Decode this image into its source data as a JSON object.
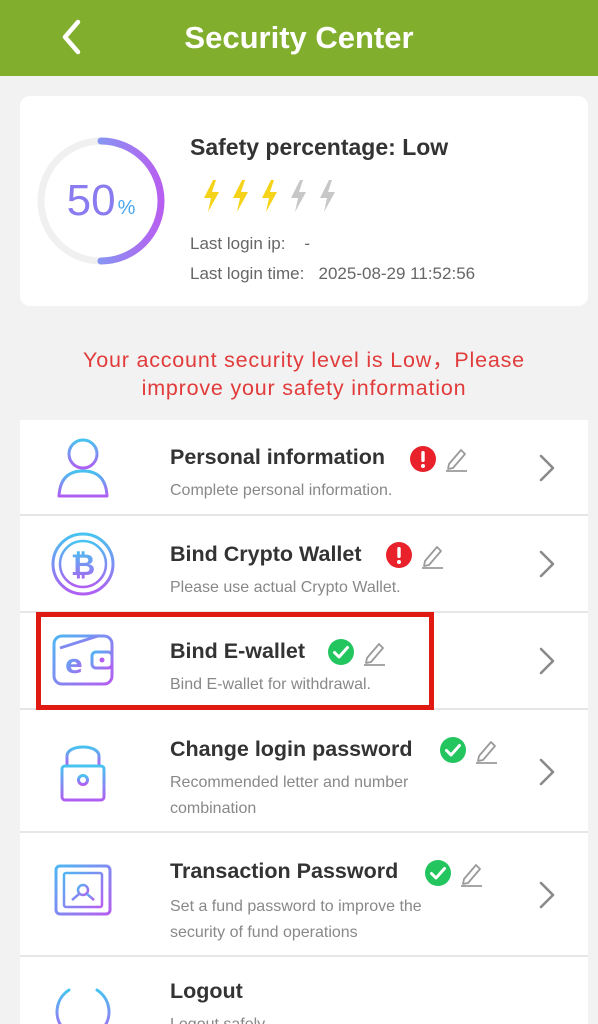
{
  "header": {
    "title": "Security Center"
  },
  "summary": {
    "percent": "50",
    "percent_sign": "%",
    "safety_label": "Safety percentage: Low",
    "bolts_lit": 3,
    "bolts_total": 5,
    "last_login_ip": "Last login ip:    -",
    "last_login_time": "Last login time:   2025-08-29 11:52:56"
  },
  "warning": {
    "line1": "Your account security level is Low，Please",
    "line2": "improve your safety information"
  },
  "colors": {
    "header": "#82ae2e",
    "warning": "#e23b3b",
    "ok": "#22c55e",
    "alert": "#e8212a",
    "bolt_on": "#f5d31a",
    "bolt_off": "#c7c7c7"
  },
  "menu": [
    {
      "title": "Personal information",
      "desc": "Complete personal information.",
      "status": "alert",
      "icon": "user-icon"
    },
    {
      "title": "Bind Crypto Wallet",
      "desc": "Please use actual Crypto Wallet.",
      "status": "alert",
      "icon": "bitcoin-icon"
    },
    {
      "title": "Bind E-wallet",
      "desc": "Bind E-wallet for withdrawal.",
      "status": "ok",
      "icon": "wallet-icon"
    },
    {
      "title": "Change login password",
      "desc": "Recommended letter and number combination",
      "status": "ok",
      "icon": "lock-icon"
    },
    {
      "title": "Transaction Password",
      "desc": "Set a fund password to improve the security of fund operations",
      "status": "ok",
      "icon": "safe-icon"
    },
    {
      "title": "Logout",
      "desc": "Logout safely",
      "icon": "power-icon"
    }
  ]
}
